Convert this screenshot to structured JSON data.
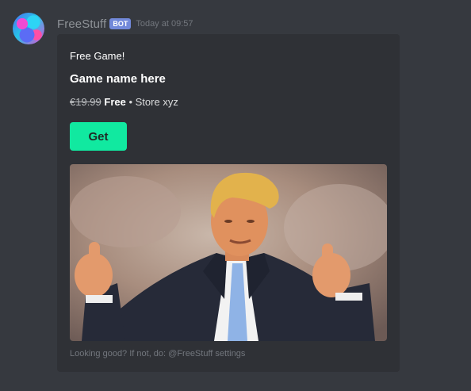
{
  "message": {
    "username": "FreeStuff",
    "badge": "BOT",
    "timestamp": "Today at 09:57"
  },
  "embed": {
    "author": "Free Game!",
    "title": "Game name here",
    "price_old": "€19.99",
    "price_new": "Free",
    "separator": " • ",
    "store": "Store xyz",
    "button_label": "Get",
    "footer": "Looking good? If not, do: @FreeStuff settings",
    "accent_color": "#11e9a0"
  }
}
